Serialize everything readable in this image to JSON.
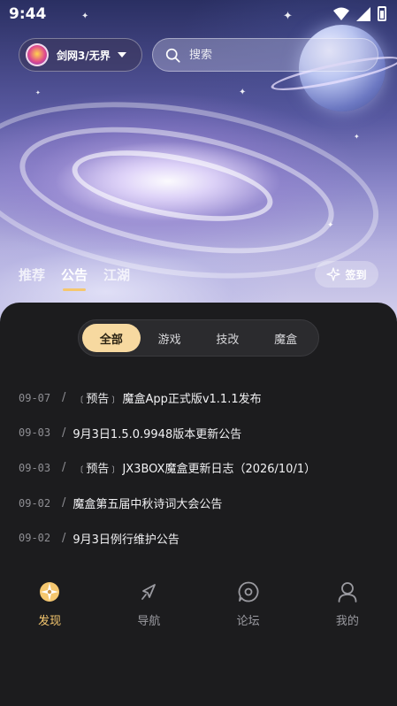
{
  "status_bar": {
    "time": "9:44"
  },
  "header": {
    "game_switcher_label": "剑网3/无界",
    "search_placeholder": "搜索"
  },
  "hero_tabs": [
    {
      "label": "推荐",
      "active": false
    },
    {
      "label": "公告",
      "active": true
    },
    {
      "label": "江湖",
      "active": false
    }
  ],
  "checkin_label": "签到",
  "filters": [
    {
      "label": "全部",
      "active": true
    },
    {
      "label": "游戏",
      "active": false
    },
    {
      "label": "技改",
      "active": false
    },
    {
      "label": "魔盒",
      "active": false
    }
  ],
  "announcements": [
    {
      "date": "09-07",
      "tag": "预告",
      "title": "魔盒App正式版v1.1.1发布"
    },
    {
      "date": "09-03",
      "tag": "",
      "title": "9月3日1.5.0.9948版本更新公告"
    },
    {
      "date": "09-03",
      "tag": "预告",
      "title": "JX3BOX魔盒更新日志（2026/10/1）"
    },
    {
      "date": "09-02",
      "tag": "",
      "title": "魔盒第五届中秋诗词大会公告"
    },
    {
      "date": "09-02",
      "tag": "",
      "title": "9月3日例行维护公告"
    }
  ],
  "separator": "/",
  "bottom_nav": [
    {
      "label": "发现",
      "icon": "discover-icon",
      "active": true
    },
    {
      "label": "导航",
      "icon": "compass-icon",
      "active": false
    },
    {
      "label": "论坛",
      "icon": "forum-icon",
      "active": false
    },
    {
      "label": "我的",
      "icon": "profile-icon",
      "active": false
    }
  ],
  "colors": {
    "accent": "#f5c76f",
    "active_chip": "#f7d9a0",
    "sheet_bg": "#1c1c1e"
  }
}
